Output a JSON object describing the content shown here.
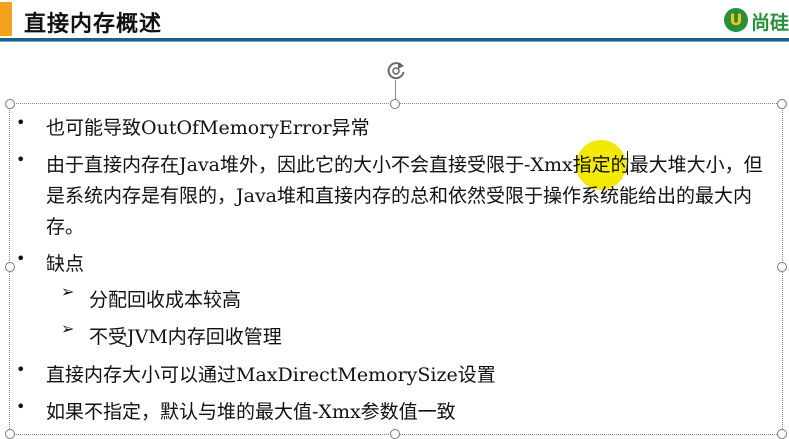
{
  "slide": {
    "title": "直接内存概述",
    "logo_text": "尚硅"
  },
  "bullets": [
    {
      "level": 1,
      "marker": "•",
      "text": "也可能导致OutOfMemoryError异常"
    },
    {
      "level": 1,
      "marker": "•",
      "text": "由于直接内存在Java堆外，因此它的大小不会直接受限于-Xmx指定的最大堆大小，但是系统内存是有限的，Java堆和直接内存的总和依然受限于操作系统能给出的最大内存。"
    },
    {
      "level": 1,
      "marker": "•",
      "text": "缺点"
    },
    {
      "level": 2,
      "marker": "➢",
      "text": "分配回收成本较高"
    },
    {
      "level": 2,
      "marker": "➢",
      "text": "不受JVM内存回收管理"
    },
    {
      "level": 1,
      "marker": "•",
      "text": "直接内存大小可以通过MaxDirectMemorySize设置"
    },
    {
      "level": 1,
      "marker": "•",
      "text": "如果不指定，默认与堆的最大值-Xmx参数值一致"
    }
  ],
  "colors": {
    "accent": "#f2a31b",
    "title_rule": "#1b5f8a",
    "logo_green": "#2a8f3a",
    "laser_pointer": "#f2e800"
  },
  "icons": {
    "rotate_handle": "rotate-icon",
    "logo": "logo-icon"
  }
}
